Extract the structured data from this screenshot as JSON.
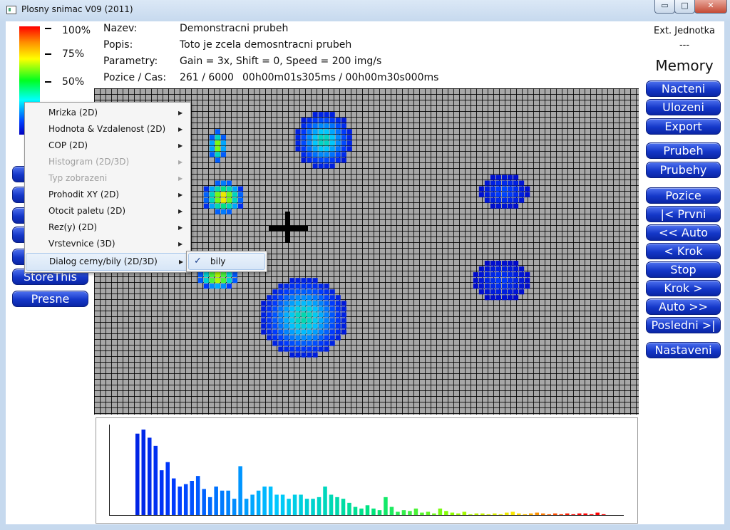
{
  "window": {
    "title": "Plosny snimac V09 (2011)",
    "minimize": "▭",
    "maximize": "□",
    "close": "✕"
  },
  "palette": {
    "labels": [
      "100%",
      "75%",
      "50%"
    ]
  },
  "info": {
    "nazev_label": "Nazev:",
    "nazev_value": "Demonstracni prubeh",
    "popis_label": "Popis:",
    "popis_value": "Toto je zcela demosntracni prubeh",
    "param_label": "Parametry:",
    "param_value": "Gain = 3x, Shift = 0, Speed = 200 img/s",
    "pozice_label": "Pozice / Cas:",
    "pozice_value": "261 / 6000",
    "cas_value": "00h00m01s305ms / 00h00m30s000ms"
  },
  "ext": {
    "label": "Ext. Jednotka",
    "value": "---",
    "memory": "Memory"
  },
  "right_buttons": [
    "Nacteni",
    "Ulozeni",
    "Export",
    "Prubeh",
    "Prubehy",
    "Pozice",
    "|< Prvni",
    "<< Auto",
    "< Krok",
    "Stop",
    "Krok >",
    "Auto >>",
    "Posledni >|",
    "Nastaveni"
  ],
  "left_buttons": {
    "store": "StoreThis",
    "presne": "Presne"
  },
  "context_menu": {
    "items": [
      {
        "label": "Mrizka (2D)",
        "enabled": true
      },
      {
        "label": "Hodnota & Vzdalenost (2D)",
        "enabled": true
      },
      {
        "label": "COP (2D)",
        "enabled": true
      },
      {
        "label": "Histogram (2D/3D)",
        "enabled": false
      },
      {
        "label": "Typ zobrazeni",
        "enabled": false
      },
      {
        "label": "Prohodit XY (2D)",
        "enabled": true
      },
      {
        "label": "Otocit paletu (2D)",
        "enabled": true
      },
      {
        "label": "Rez(y) (2D)",
        "enabled": true
      },
      {
        "label": "Vrstevnice (3D)",
        "enabled": true
      },
      {
        "label": "Dialog cerny/bily (2D/3D)",
        "enabled": true,
        "highlighted": true
      }
    ],
    "submenu": {
      "check": "✓",
      "label": "bily"
    }
  },
  "pressure_map": {
    "grid": {
      "cols": 95,
      "rows": 57
    },
    "blobs": [
      {
        "cells": [
          [
            36,
            4
          ],
          [
            44,
            9
          ],
          [
            36,
            13
          ],
          [
            35,
            11
          ]
        ],
        "peak": 0.55
      },
      {
        "cells": [
          [
            20,
            7
          ],
          [
            22,
            12
          ]
        ],
        "peak": 0.85
      },
      {
        "cells": [
          [
            19,
            16
          ],
          [
            25,
            21
          ]
        ],
        "peak": 1.0
      },
      {
        "cells": [
          [
            18,
            31
          ],
          [
            24,
            34
          ]
        ],
        "peak": 1.0
      },
      {
        "cells": [
          [
            29,
            33
          ],
          [
            43,
            46
          ]
        ],
        "peak": 0.55
      },
      {
        "cells": [
          [
            67,
            15
          ],
          [
            75,
            20
          ]
        ],
        "peak": 0.25
      },
      {
        "cells": [
          [
            66,
            30
          ],
          [
            75,
            36
          ]
        ],
        "peak": 0.2
      }
    ]
  },
  "histogram": {
    "values": [
      100,
      105,
      95,
      85,
      55,
      65,
      45,
      35,
      38,
      42,
      48,
      32,
      22,
      35,
      30,
      30,
      20,
      60,
      20,
      25,
      30,
      35,
      35,
      25,
      25,
      20,
      25,
      25,
      20,
      20,
      22,
      35,
      25,
      22,
      20,
      15,
      10,
      8,
      12,
      8,
      6,
      22,
      10,
      4,
      6,
      5,
      8,
      3,
      4,
      2,
      8,
      5,
      3,
      2,
      4,
      1,
      2,
      2,
      1,
      2,
      1,
      3,
      4,
      2,
      1,
      2,
      3,
      2,
      1,
      2,
      1,
      2,
      1,
      2,
      2,
      1,
      3,
      1
    ]
  }
}
